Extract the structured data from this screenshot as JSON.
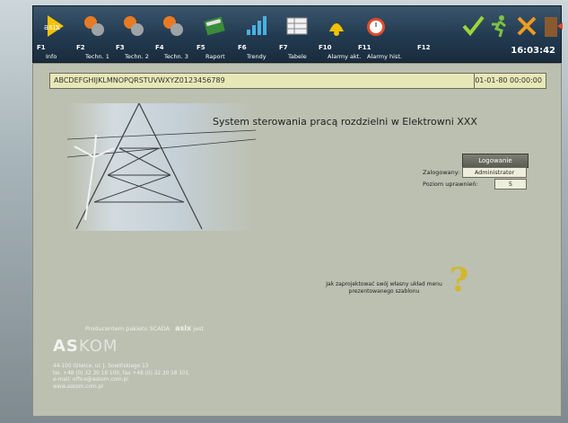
{
  "toolbar": {
    "buttons": [
      {
        "key": "F1",
        "label": "Info",
        "icon": "asix-logo-icon"
      },
      {
        "key": "F2",
        "label": "Techn. 1",
        "icon": "gears-icon"
      },
      {
        "key": "F3",
        "label": "Techn. 2",
        "icon": "gears-icon"
      },
      {
        "key": "F4",
        "label": "Techn. 3",
        "icon": "gears-icon"
      },
      {
        "key": "F5",
        "label": "Raport",
        "icon": "book-icon"
      },
      {
        "key": "F6",
        "label": "Trendy",
        "icon": "bar-chart-icon"
      },
      {
        "key": "F7",
        "label": "Tabele",
        "icon": "table-icon"
      },
      {
        "key": "F10",
        "label": "Alarmy akt.",
        "icon": "bell-icon"
      },
      {
        "key": "F11",
        "label": "Alarmy hist.",
        "icon": "alarm-clock-icon"
      },
      {
        "key": "F12",
        "label": "",
        "icon": "checkmark-icon"
      }
    ],
    "clock": "16:03:42"
  },
  "message_bar": {
    "text": "ABCDEFGHIJKLMNOPQRSTUVWXYZ0123456789",
    "datetime": "01-01-80 00:00:00"
  },
  "main": {
    "title": "System sterowania pracą rozdzielni w Elektrowni XXX",
    "login_button": "Logowanie",
    "logged_label": "Zalogowany:",
    "logged_value": "Administrator",
    "level_label": "Poziom uprawnień:",
    "level_value": "5",
    "help_text": "Jak zaprojektować swój własny układ menu prezentowanego szablonu"
  },
  "footer": {
    "producer_text": "Producentem pakietu SCADA",
    "producer_brand": "asix",
    "producer_suffix": "jest",
    "company_as": "AS",
    "company_kom": "KOM",
    "address_1": "44-100 Gliwice, ul. J. Sowińskiego 13",
    "address_2": "tel. +48 (0) 32 30 18 100, fax +48 (0) 32 30 18 101",
    "email": "e-mail: office@askom.com.pl",
    "www": "www.askom.com.pl"
  }
}
